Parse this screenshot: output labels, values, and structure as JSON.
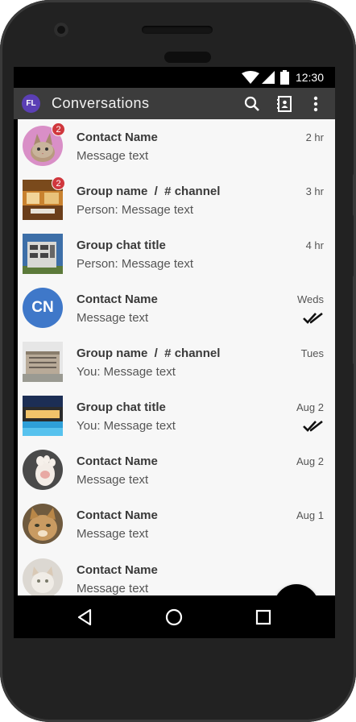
{
  "status": {
    "time": "12:30"
  },
  "appbar": {
    "account_initials": "FL",
    "title": "Conversations"
  },
  "conversations": [
    {
      "name": "Contact Name",
      "message": "Message text",
      "time": "2 hr",
      "badge": "2"
    },
    {
      "name": "Group name  /  # channel",
      "message": "Person: Message text",
      "time": "3 hr",
      "badge": "2"
    },
    {
      "name": "Group chat title",
      "message": "Person: Message text",
      "time": "4 hr"
    },
    {
      "name": "Contact Name",
      "message": "Message text",
      "time": "Weds",
      "initials": "CN",
      "read": true
    },
    {
      "name": "Group name  /  # channel",
      "message": "You: Message text",
      "time": "Tues"
    },
    {
      "name": "Group chat title",
      "message": "You: Message text",
      "time": "Aug 2",
      "read": true
    },
    {
      "name": "Contact Name",
      "message": "Message text",
      "time": "Aug 2"
    },
    {
      "name": "Contact Name",
      "message": "Message text",
      "time": "Aug 1"
    },
    {
      "name": "Contact Name",
      "message": "Message text"
    }
  ],
  "fab": {
    "symbol": "+"
  },
  "colors": {
    "appbar": "#3c3c3c",
    "account_avatar": "#5b3fb5",
    "badge": "#d0373d",
    "cn_avatar": "#3f78c9",
    "list_bg": "#f7f7f7"
  }
}
